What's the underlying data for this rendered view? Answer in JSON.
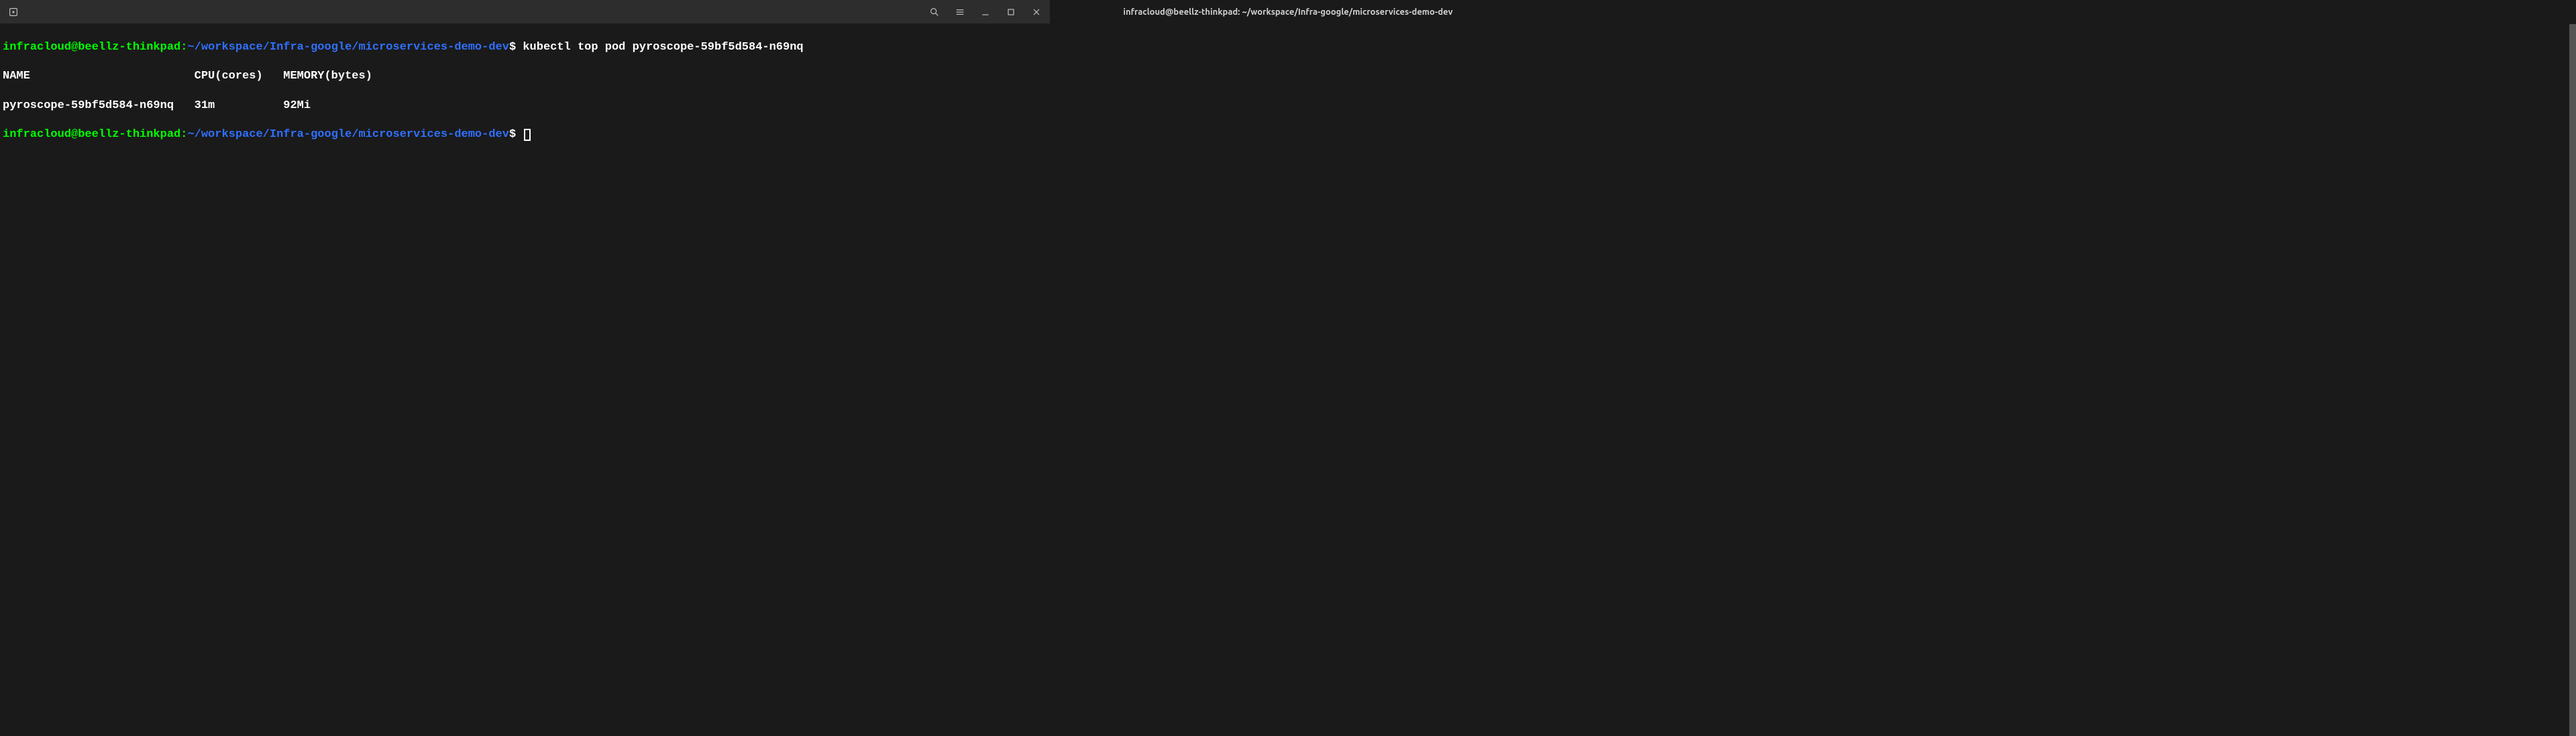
{
  "titlebar": {
    "title": "infracloud@beellz-thinkpad: ~/workspace/Infra-google/microservices-demo-dev"
  },
  "terminal": {
    "prompt": {
      "user": "infracloud@beellz-thinkpad",
      "separator": ":",
      "path": "~/workspace/Infra-google/microservices-demo-dev",
      "symbol": "$"
    },
    "command": " kubectl top pod pyroscope-59bf5d584-n69nq",
    "output": {
      "header": "NAME                        CPU(cores)   MEMORY(bytes)   ",
      "row": "pyroscope-59bf5d584-n69nq   31m          92Mi            "
    }
  }
}
